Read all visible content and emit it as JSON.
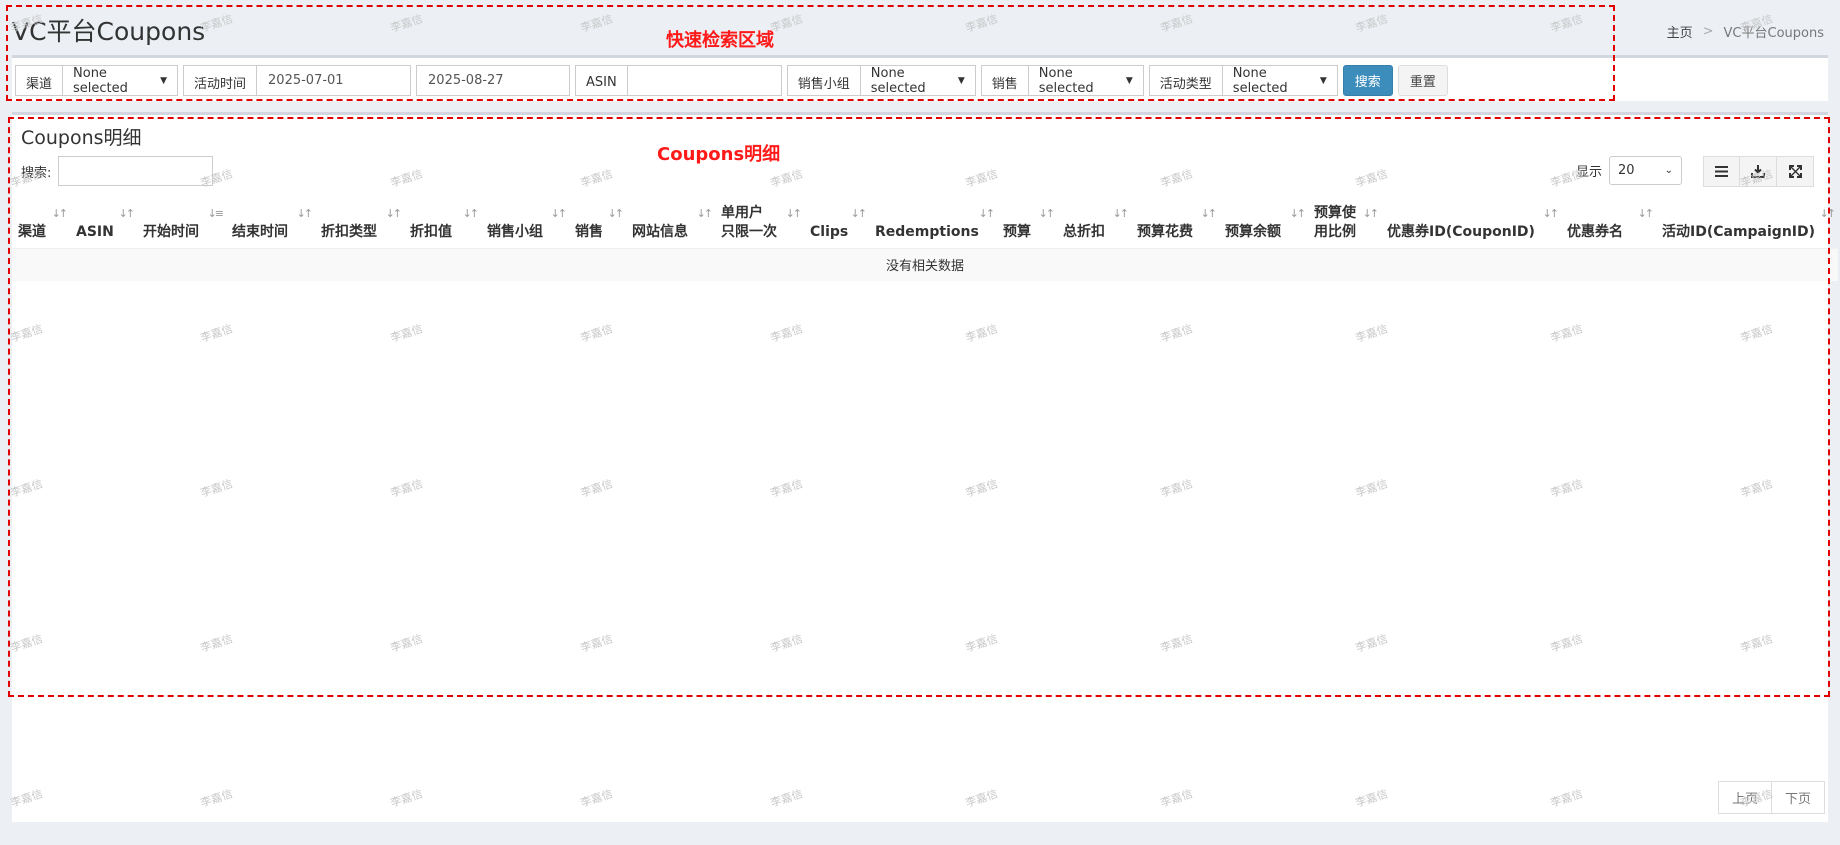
{
  "header": {
    "title": "VC平台Coupons",
    "breadcrumb": [
      "主页",
      "VC平台Coupons"
    ],
    "breadcrumb_sep": ">"
  },
  "annotations": {
    "search_area": "快速检索区域",
    "detail_area": "Coupons明细",
    "color": "#ff0000"
  },
  "filters": {
    "channel": {
      "label": "渠道",
      "value": "None selected"
    },
    "activity_time": {
      "label": "活动时间",
      "start": "2025-07-01",
      "end": "2025-08-27"
    },
    "asin": {
      "label": "ASIN",
      "value": ""
    },
    "sales_team": {
      "label": "销售小组",
      "value": "None selected"
    },
    "sales": {
      "label": "销售",
      "value": "None selected"
    },
    "activity_type": {
      "label": "活动类型",
      "value": "None selected"
    },
    "search_button": "搜索",
    "reset_button": "重置"
  },
  "detail": {
    "title": "Coupons明细",
    "search_label": "搜索:",
    "show_label": "显示",
    "page_size": "20",
    "columns": [
      [
        "渠道"
      ],
      [
        "ASIN"
      ],
      [
        "开始时间"
      ],
      [
        "结束时间"
      ],
      [
        "折扣类型"
      ],
      [
        "折扣值"
      ],
      [
        "销售小组"
      ],
      [
        "销售"
      ],
      [
        "网站信息"
      ],
      [
        "单用户",
        "只限一次"
      ],
      [
        "Clips"
      ],
      [
        "Redemptions"
      ],
      [
        "预算"
      ],
      [
        "总折扣"
      ],
      [
        "预算花费"
      ],
      [
        "预算余额"
      ],
      [
        "预算使",
        "用比例"
      ],
      [
        "优惠券ID(CouponID)"
      ],
      [
        "优惠券名"
      ],
      [
        "活动ID(CampaignID)"
      ]
    ],
    "empty_text": "没有相关数据",
    "prev_page": "上页",
    "next_page": "下页"
  },
  "watermark": "李嘉信",
  "colors": {
    "primary": "#3c8dbc",
    "background": "#ecf0f5"
  }
}
